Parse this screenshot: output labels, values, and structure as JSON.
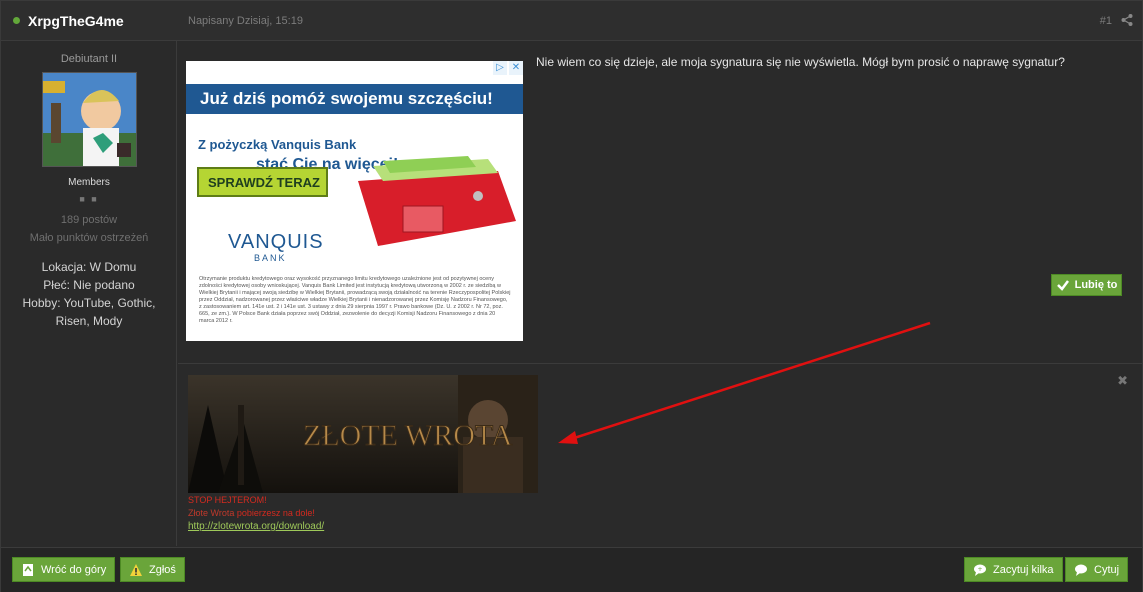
{
  "post": {
    "author": "XrpgTheG4me",
    "date": "Napisany Dzisiaj, 15:19",
    "number": "#1",
    "message": "Nie wiem co się dzieje, ale moja sygnatura się nie wyświetla. Mógł bym prosić o naprawę sygnatur?",
    "like_label": "Lubię to"
  },
  "sidebar": {
    "rank": "Debiutant II",
    "group": "Members",
    "posts": "189 postów",
    "warn": "Mało punktów ostrzeżeń",
    "fields": [
      "Lokacja: W Domu",
      "Płeć: Nie podano",
      "Hobby: YouTube, Gothic,",
      "Risen, Mody"
    ]
  },
  "ad": {
    "headline": "Już dziś pomóż swojemu szczęściu!",
    "sub1": "Z pożyczką Vanquis Bank",
    "sub2": "stać Cię na więcej!",
    "cta": "SPRAWDŹ TERAZ",
    "brand": "VANQUIS",
    "brand_sub": "BANK",
    "fine": "Otrzymanie produktu kredytowego oraz wysokość przyznanego limitu kredytowego uzależnione jest od pozytywnej oceny zdolności kredytowej osoby wnioskującej. Vanquis Bank Limited jest instytucją kredytową utworzoną w 2002 r. ze siedzibą w Wielkiej Brytanii i mającej swoją siedzibę w Wielkiej Brytanii, prowadzącą swoją działalność na terenie Rzeczypospolitej Polskiej przez Oddział, nadzorowanej przez właściwe władze Wielkiej Brytanii i nienadzorowanej przez Komisję Nadzoru Finansowego, z zastosowaniem art. 141e ust. 2 i 141e ust. 3 ustawy z dnia 29 sierpnia 1997 r. Prawo bankowe (Dz. U. z 2002 r. Nr 72, poz. 665, ze zm.). W Polsce Bank działa poprzez swój Oddział, zezwolenie do decyzji Komisji Nadzoru Finansowego z dnia 20 marca 2012 r."
  },
  "signature": {
    "banner_text": "ZŁOTE WROTA",
    "line1": "STOP HEJTEROM!",
    "line2_a": "Złote Wrota",
    "line2_b": "pobierzesz na dole!",
    "link": "http://zlotewrota.org/download/"
  },
  "footer": {
    "top_label": "Wróć do góry",
    "report_label": "Zgłoś",
    "multiquote_label": "Zacytuj kilka",
    "quote_label": "Cytuj"
  },
  "colors": {
    "accent_green": "#6aa53a",
    "annotation_arrow": "#e01010"
  }
}
